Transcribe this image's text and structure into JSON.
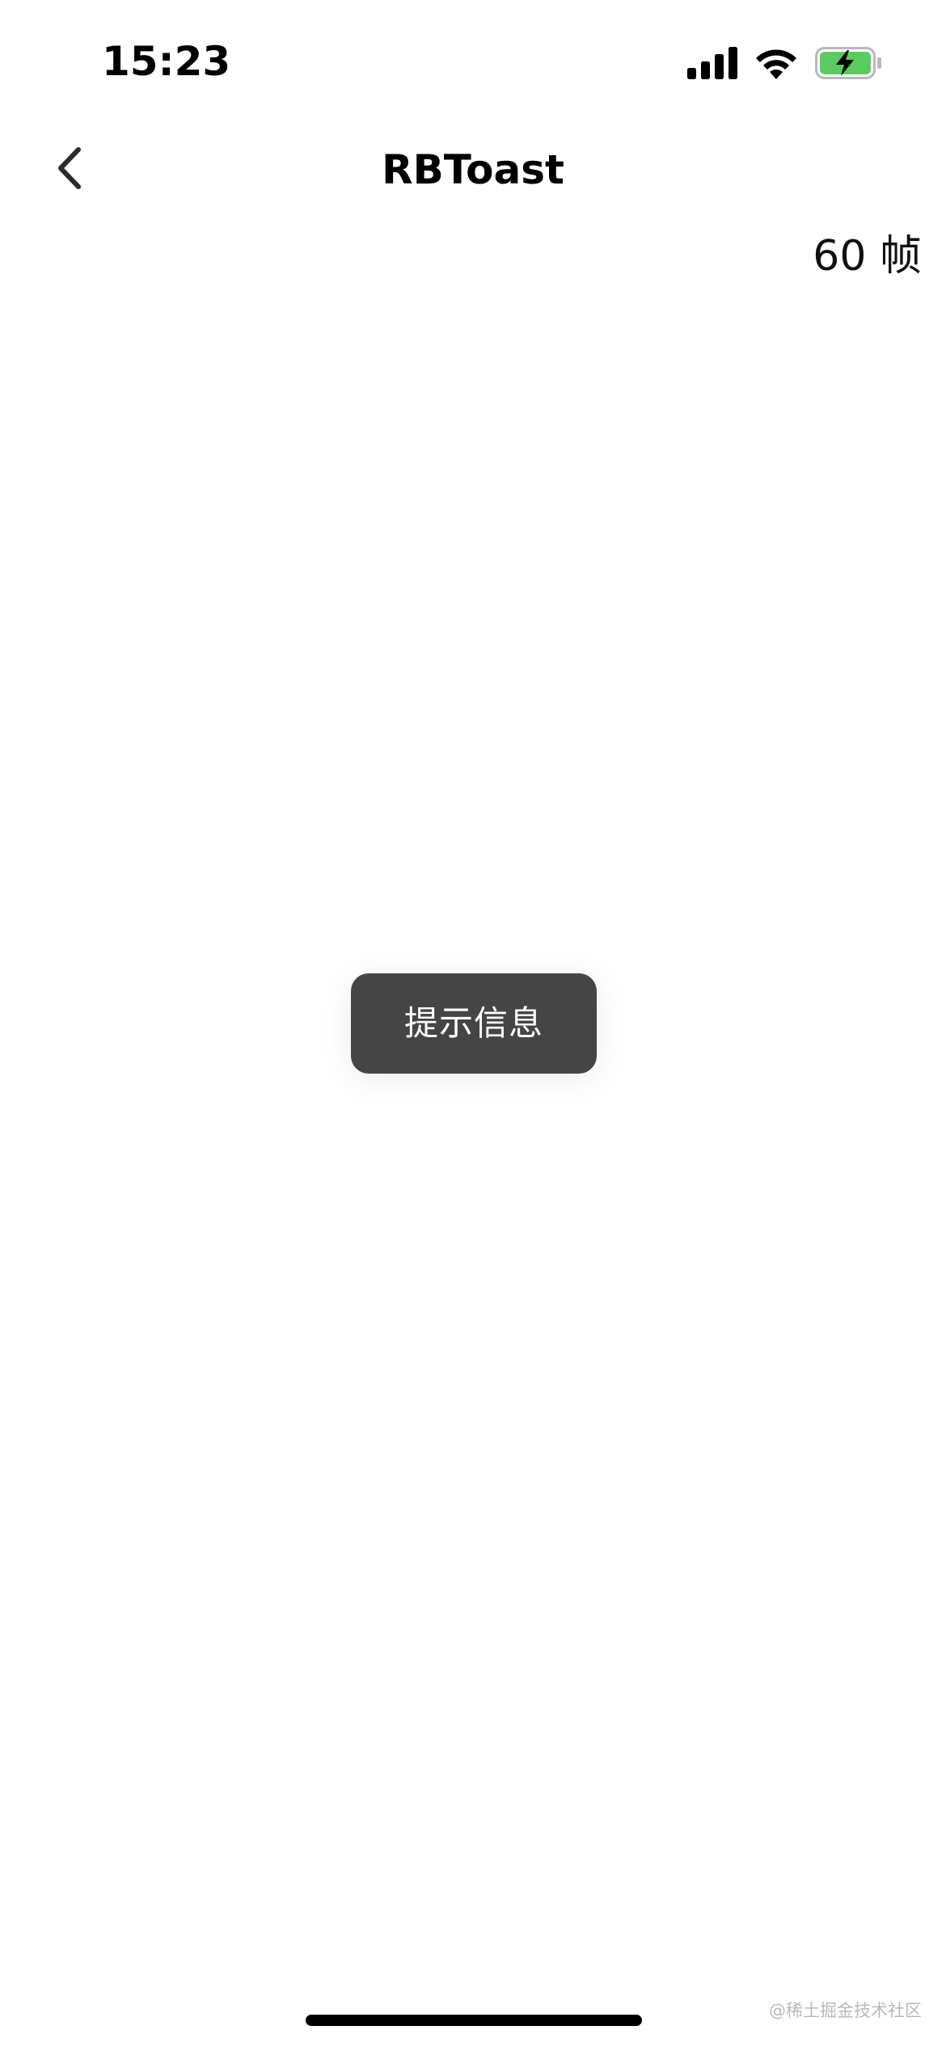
{
  "status_bar": {
    "time": "15:23",
    "icons": [
      "cellular-signal-icon",
      "wifi-icon",
      "battery-charging-icon"
    ],
    "battery_color": "#5ACB5F"
  },
  "nav": {
    "back_icon": "chevron-left-icon",
    "title": "RBToast"
  },
  "fps": {
    "label": "60 帧"
  },
  "toast": {
    "message": "提示信息",
    "background": "#454545"
  },
  "watermark": {
    "text": "@稀土掘金技术社区"
  }
}
